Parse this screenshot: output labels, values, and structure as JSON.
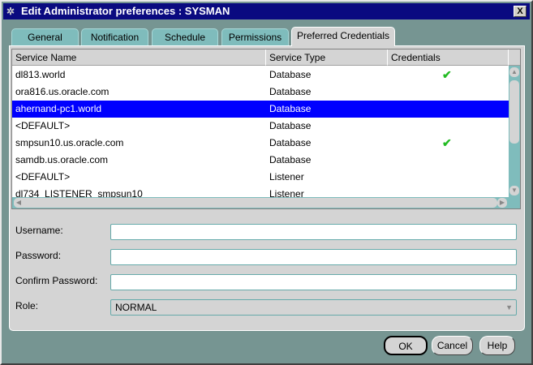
{
  "window": {
    "title": "Edit Administrator preferences : SYSMAN",
    "close": "X"
  },
  "tabs": [
    {
      "label": "General"
    },
    {
      "label": "Notification"
    },
    {
      "label": "Schedule"
    },
    {
      "label": "Permissions"
    },
    {
      "label": "Preferred Credentials",
      "active": true
    }
  ],
  "table": {
    "columns": [
      "Service Name",
      "Service Type",
      "Credentials"
    ],
    "rows": [
      {
        "name": "dl813.world",
        "type": "Database",
        "cred": "✔"
      },
      {
        "name": "ora816.us.oracle.com",
        "type": "Database",
        "cred": ""
      },
      {
        "name": "ahernand-pc1.world",
        "type": "Database",
        "cred": "",
        "selected": true
      },
      {
        "name": "<DEFAULT>",
        "type": "Database",
        "cred": ""
      },
      {
        "name": "smpsun10.us.oracle.com",
        "type": "Database",
        "cred": "✔"
      },
      {
        "name": "samdb.us.oracle.com",
        "type": "Database",
        "cred": ""
      },
      {
        "name": "<DEFAULT>",
        "type": "Listener",
        "cred": ""
      },
      {
        "name": "dl734_LISTENER_smpsun10",
        "type": "Listener",
        "cred": ""
      }
    ]
  },
  "form": {
    "username_label": "Username:",
    "username": "",
    "password_label": "Password:",
    "password": "",
    "confirm_label": "Confirm Password:",
    "confirm": "",
    "role_label": "Role:",
    "role": "NORMAL"
  },
  "buttons": {
    "ok": "OK",
    "cancel": "Cancel",
    "help": "Help"
  },
  "colors": {
    "selection": "#0000ff",
    "check": "#22bb22",
    "titlebar": "#0a0a80"
  }
}
